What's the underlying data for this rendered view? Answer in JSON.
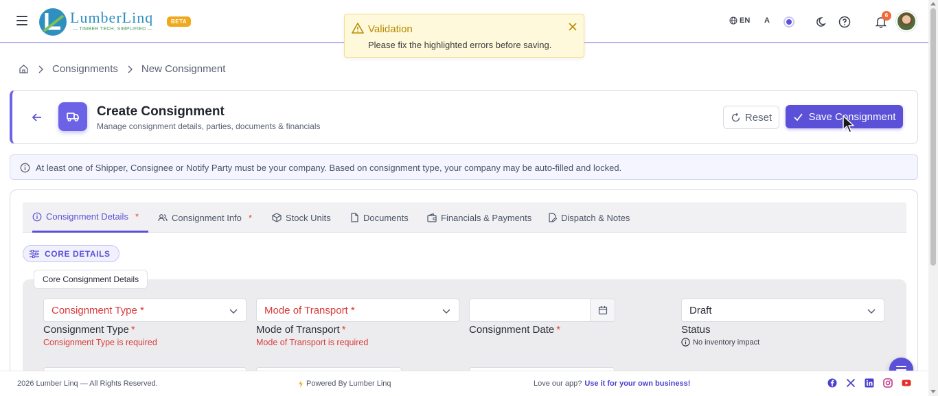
{
  "brand": {
    "name": "LumberLinq",
    "tagline": "TIMBER TECH, SIMPLIFIED",
    "badge": "BETA",
    "color": "#2f8fbf"
  },
  "topbar": {
    "language": "EN",
    "font_size_label": "A",
    "notification_count": "6"
  },
  "toast": {
    "title": "Validation",
    "message": "Please fix the highlighted errors before saving.",
    "type": "warning"
  },
  "breadcrumb": {
    "items": [
      "Consignments",
      "New Consignment"
    ]
  },
  "header": {
    "title": "Create Consignment",
    "subtitle": "Manage consignment details, parties, documents & financials",
    "reset_label": "Reset",
    "save_label": "Save Consignment"
  },
  "info_banner": {
    "text": "At least one of Shipper, Consignee or Notify Party must be your company. Based on consignment type, your company may be auto-filled and locked."
  },
  "tabs": [
    {
      "label": "Consignment Details",
      "required": "*",
      "active": true
    },
    {
      "label": "Consignment Info",
      "required": "*"
    },
    {
      "label": "Stock Units"
    },
    {
      "label": "Documents"
    },
    {
      "label": "Financials & Payments"
    },
    {
      "label": "Dispatch & Notes"
    }
  ],
  "section": {
    "chip": "CORE DETAILS",
    "legend": "Core Consignment Details"
  },
  "fields": {
    "consignment_type": {
      "placeholder": "Consignment Type *",
      "label": "Consignment Type",
      "required": "*",
      "error": "Consignment Type is required"
    },
    "mode_of_transport": {
      "placeholder": "Mode of Transport *",
      "label": "Mode of Transport",
      "required": "*",
      "error": "Mode of Transport is required"
    },
    "consignment_date": {
      "value": "",
      "label": "Consignment Date",
      "required": "*"
    },
    "status": {
      "value": "Draft",
      "label": "Status",
      "hint": "No inventory impact"
    }
  },
  "footer": {
    "copyright": "2026 Lumber Linq — All Rights Reserved.",
    "powered": "Powered By Lumber Linq",
    "love_text": "Love our app?",
    "love_link": "Use it for your own business!"
  },
  "colors": {
    "primary": "#5b51d8",
    "error": "#d93b3b",
    "warning_bg": "#fff9db",
    "warning_text": "#b88a00"
  }
}
